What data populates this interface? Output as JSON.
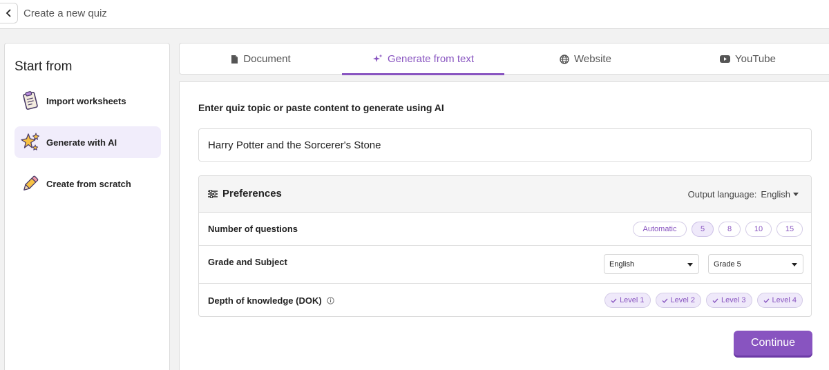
{
  "header": {
    "title": "Create a new quiz"
  },
  "sidebar": {
    "title": "Start from",
    "items": [
      {
        "label": "Import worksheets",
        "icon": "clipboard-icon"
      },
      {
        "label": "Generate with AI",
        "icon": "sparkles-icon",
        "active": true
      },
      {
        "label": "Create from scratch",
        "icon": "pencil-icon"
      }
    ]
  },
  "tabs": [
    {
      "label": "Document",
      "icon": "document-icon"
    },
    {
      "label": "Generate from text",
      "icon": "sparkle-icon",
      "active": true
    },
    {
      "label": "Website",
      "icon": "globe-icon"
    },
    {
      "label": "YouTube",
      "icon": "youtube-icon"
    }
  ],
  "main": {
    "heading": "Enter quiz topic or paste content to generate using AI",
    "topic_value": "Harry Potter and the Sorcerer's Stone"
  },
  "preferences": {
    "title": "Preferences",
    "output_language_label": "Output language:",
    "output_language_value": "English",
    "num_questions": {
      "label": "Number of questions",
      "options": [
        "Automatic",
        "5",
        "8",
        "10",
        "15"
      ],
      "selected": "5"
    },
    "grade_subject": {
      "label": "Grade and Subject",
      "subject": "English",
      "grade": "Grade 5"
    },
    "dok": {
      "label": "Depth of knowledge (DOK)",
      "levels": [
        "Level 1",
        "Level 2",
        "Level 3",
        "Level 4"
      ]
    }
  },
  "actions": {
    "continue_label": "Continue"
  },
  "colors": {
    "accent": "#8854c0",
    "accent_light": "#efe9fa",
    "border": "#dcdcdc",
    "background": "#f2f2f2"
  }
}
